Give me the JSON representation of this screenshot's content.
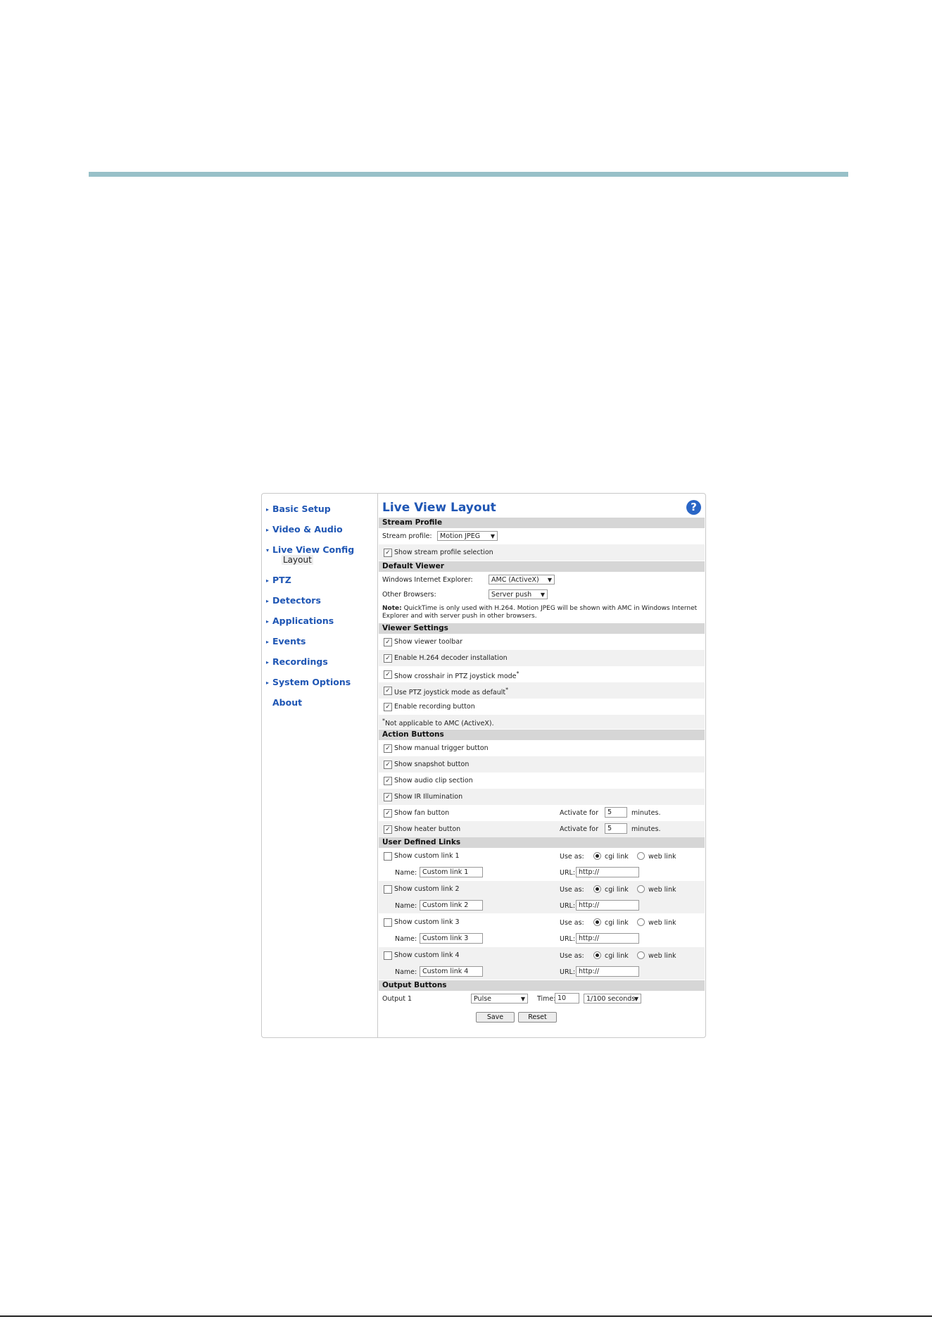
{
  "nav": {
    "items": [
      "Basic Setup",
      "Video & Audio",
      "Live View Config",
      "PTZ",
      "Detectors",
      "Applications",
      "Events",
      "Recordings",
      "System Options",
      "About"
    ],
    "sub_item": "Layout"
  },
  "page": {
    "title": "Live View Layout",
    "help": "?"
  },
  "stream_profile": {
    "header": "Stream Profile",
    "label": "Stream profile:",
    "value": "Motion JPEG",
    "show_selection": "Show stream profile selection"
  },
  "default_viewer": {
    "header": "Default Viewer",
    "ie_label": "Windows Internet Explorer:",
    "ie_value": "AMC (ActiveX)",
    "other_label": "Other Browsers:",
    "other_value": "Server push",
    "note_bold": "Note:",
    "note_text": " QuickTime is only used with H.264. Motion JPEG will be shown with AMC in Windows Internet Explorer and with server push in other browsers."
  },
  "viewer_settings": {
    "header": "Viewer Settings",
    "items": [
      "Show viewer toolbar",
      "Enable H.264 decoder installation",
      "Show crosshair in PTZ joystick mode",
      "Use PTZ joystick mode as default",
      "Enable recording button"
    ],
    "footnote": "Not applicable to AMC (ActiveX)."
  },
  "action_buttons": {
    "header": "Action Buttons",
    "items": [
      "Show manual trigger button",
      "Show snapshot button",
      "Show audio clip section",
      "Show IR Illumination",
      "Show fan button",
      "Show heater button"
    ],
    "activate_label": "Activate for",
    "minutes_label": "minutes.",
    "fan_minutes": "5",
    "heater_minutes": "5"
  },
  "user_links": {
    "header": "User Defined Links",
    "links": [
      {
        "label": "Show custom link 1",
        "name": "Custom link 1",
        "url": "http://"
      },
      {
        "label": "Show custom link 2",
        "name": "Custom link 2",
        "url": "http://"
      },
      {
        "label": "Show custom link 3",
        "name": "Custom link 3",
        "url": "http://"
      },
      {
        "label": "Show custom link 4",
        "name": "Custom link 4",
        "url": "http://"
      }
    ],
    "use_as": "Use as:",
    "cgi": "cgi link",
    "web": "web link",
    "name_label": "Name:",
    "url_label": "URL:"
  },
  "output_buttons": {
    "header": "Output Buttons",
    "output_label": "Output 1",
    "mode": "Pulse",
    "time_label": "Time:",
    "time_value": "10",
    "unit": "1/100 seconds"
  },
  "buttons": {
    "save": "Save",
    "reset": "Reset"
  },
  "icons": {
    "check": "✓",
    "arrow": "▼",
    "nav_arrow": "▸",
    "nav_arrow_open": "▾"
  }
}
